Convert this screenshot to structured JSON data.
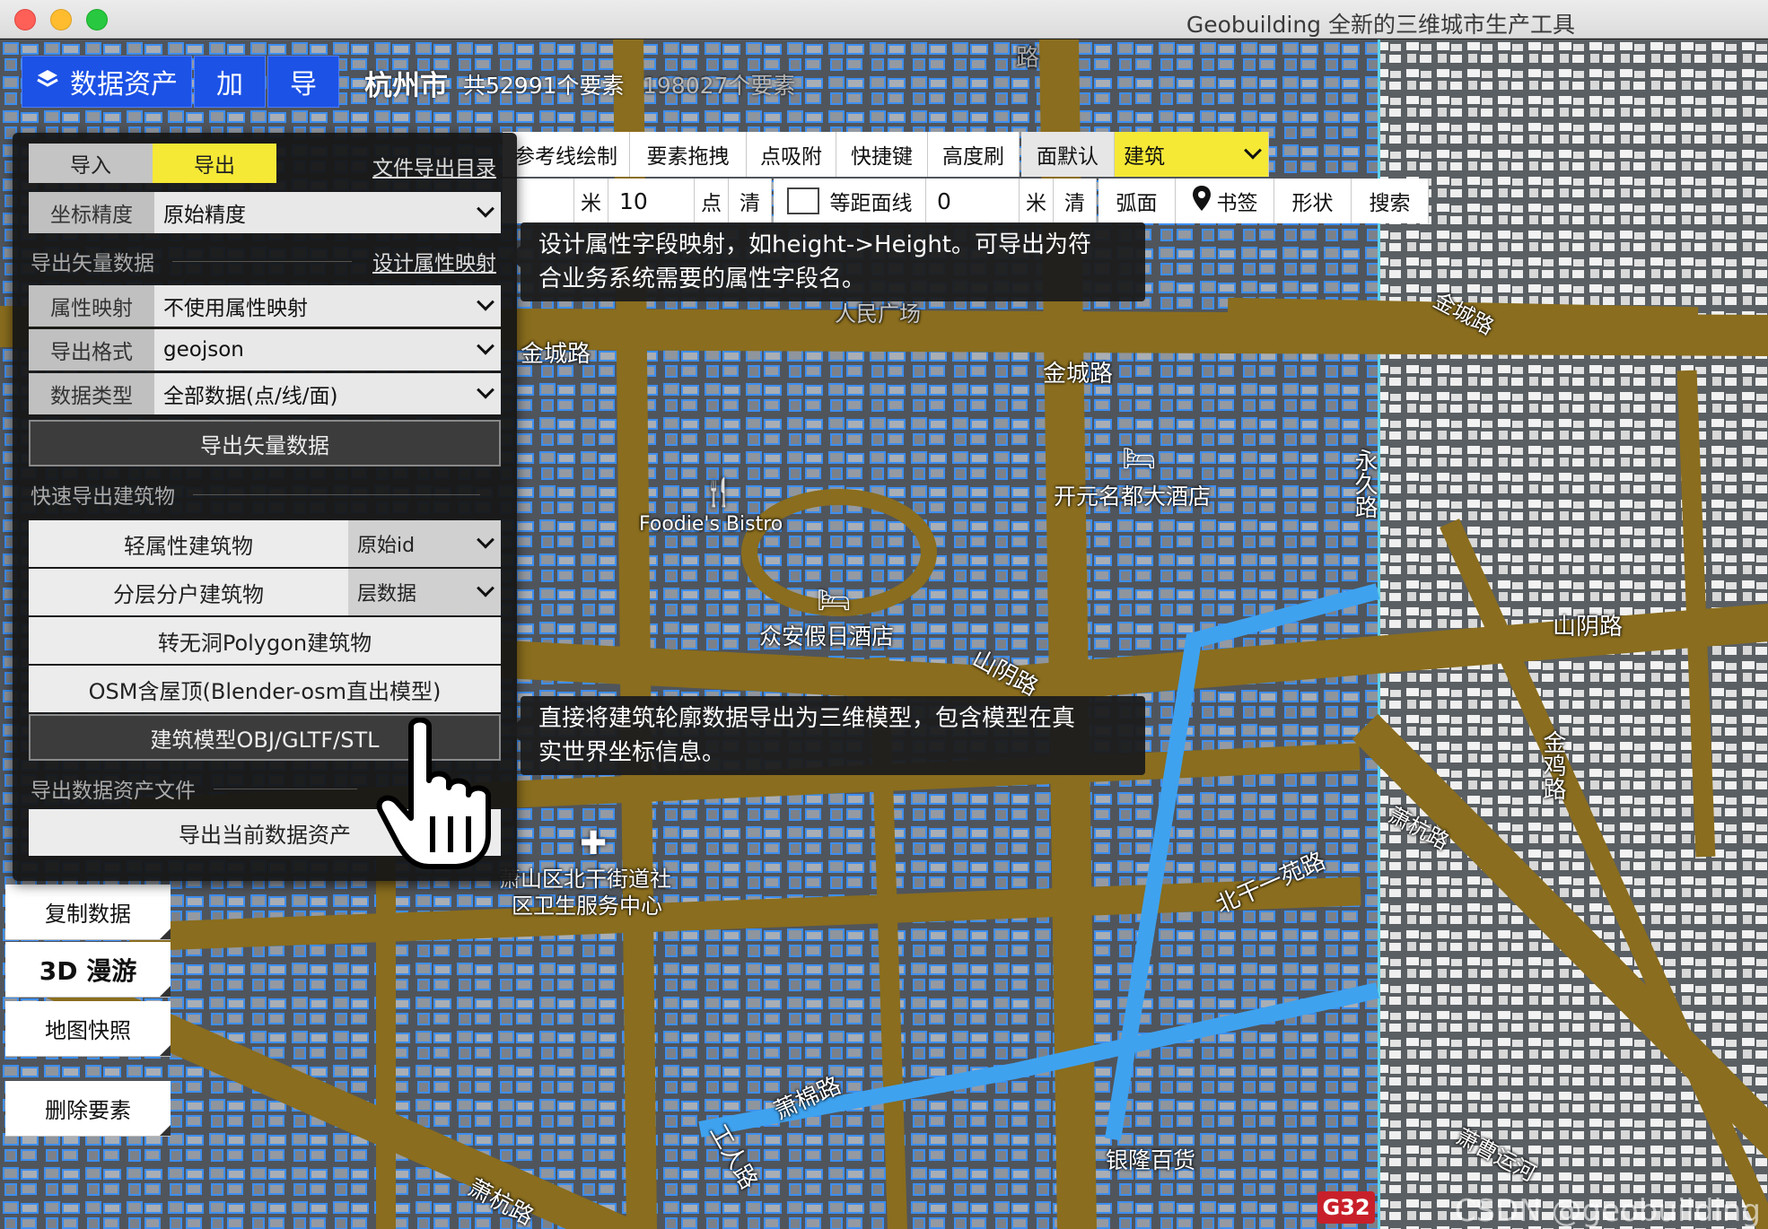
{
  "window": {
    "title": "Geobuilding 全新的三维城市生产工具"
  },
  "header": {
    "assets_button": "数据资产",
    "add_button": "加",
    "nav_button": "导",
    "city": "杭州市",
    "count_total": "共52991个要素",
    "count_secondary": "198027个要素"
  },
  "toolbar": {
    "row1": [
      "参考线绘制",
      "要素拖拽",
      "点吸附",
      "快捷键",
      "高度刷",
      "面默认"
    ],
    "layer_select": "建筑",
    "row2": {
      "unit1": "米",
      "value1": "10",
      "point": "点",
      "clear1": "清",
      "contour": "等距面线",
      "value2": "0",
      "unit2": "米",
      "clear2": "清",
      "arc": "弧面",
      "bookmark": "书签",
      "shape": "形状",
      "search": "搜索"
    }
  },
  "panel": {
    "tab_import": "导入",
    "tab_export": "导出",
    "file_dir_link": "文件导出目录",
    "precision_label": "坐标精度",
    "precision_value": "原始精度",
    "vector_section": "导出矢量数据",
    "mapping_link": "设计属性映射",
    "attr_label": "属性映射",
    "attr_value": "不使用属性映射",
    "format_label": "导出格式",
    "format_value": "geojson",
    "type_label": "数据类型",
    "type_value": "全部数据(点/线/面)",
    "export_vector_btn": "导出矢量数据",
    "quick_section": "快速导出建筑物",
    "light_btn": "轻属性建筑物",
    "light_opt": "原始id",
    "layered_btn": "分层分户建筑物",
    "layered_opt": "层数据",
    "nohole_btn": "转无洞Polygon建筑物",
    "osm_btn": "OSM含屋顶(Blender-osm直出模型)",
    "model_btn": "建筑模型OBJ/GLTF/STL",
    "asset_section": "导出数据资产文件",
    "asset_btn": "导出当前数据资产"
  },
  "tooltips": {
    "mapping": [
      "设计属性字段映射，如height->Height。可导出为符",
      "合业务系统需要的属性字段名。"
    ],
    "model": [
      "直接将建筑轮廓数据导出为三维模型，包含模型在真",
      "实世界坐标信息。"
    ]
  },
  "side_buttons": [
    "复制数据",
    "3D 漫游",
    "地图快照",
    "删除要素"
  ],
  "map_labels": {
    "jincheng1": "金城路",
    "jincheng2": "金城路",
    "jincheng3": "金城路",
    "renmin": "人民广场",
    "yongjiu": "永久路",
    "kaiyuan": "开元名都大酒店",
    "foodie": "Foodie's Bistro",
    "zhongan": "众安假日酒店",
    "shanyin1": "山阴路",
    "shanyin2": "山阴路",
    "jinji": "金鸡路",
    "beiganyiyuan": "北干一苑路",
    "xiaomian": "萧棉路",
    "gongren": "工人路",
    "xiaohang": "萧杭路",
    "yinlong": "银隆百货",
    "health1": "萧山区北干街道社",
    "health2": "区卫生服务中心",
    "xiaocao": "萧曹运河",
    "xiaoshan": "萧杭路",
    "road_top": "路",
    "g32": "G32",
    "watermark": "CSDN @geobuilding"
  },
  "colors": {
    "accent_blue": "#1c52e6",
    "tab_yellow": "#f5e936",
    "road": "#8a6d1e",
    "footprint": "#3d8ef0"
  }
}
